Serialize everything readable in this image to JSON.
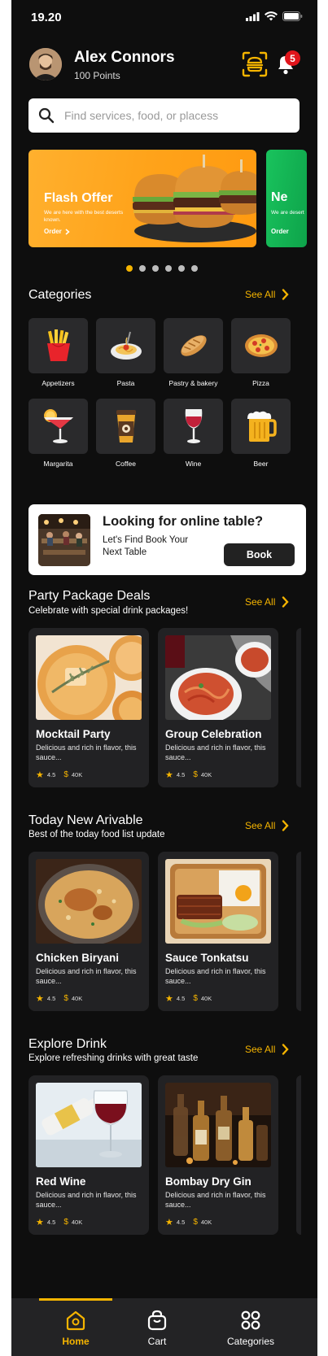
{
  "status": {
    "time": "19.20"
  },
  "header": {
    "name": "Alex Connors",
    "points": "100 Points",
    "notification_count": "5"
  },
  "search": {
    "placeholder": "Find services, food, or placess"
  },
  "banners": [
    {
      "title": "Flash Offer",
      "subtitle": "We are here with the best deserts known.",
      "cta": "Order"
    },
    {
      "title": "Ne",
      "subtitle": "We are desert",
      "cta": "Order"
    }
  ],
  "carousel": {
    "total": 6,
    "active": 0
  },
  "categories": {
    "title": "Categories",
    "see_all": "See All",
    "items": [
      {
        "label": "Appetizers",
        "icon": "fries-icon"
      },
      {
        "label": "Pasta",
        "icon": "pasta-icon"
      },
      {
        "label": "Pastry & bakery",
        "icon": "bread-icon"
      },
      {
        "label": "Pizza",
        "icon": "pizza-icon"
      },
      {
        "label": "Margarita",
        "icon": "cocktail-icon"
      },
      {
        "label": "Coffee",
        "icon": "coffee-cup-icon"
      },
      {
        "label": "Wine",
        "icon": "wine-glass-icon"
      },
      {
        "label": "Beer",
        "icon": "beer-mug-icon"
      }
    ]
  },
  "table_promo": {
    "title": "Looking for online table?",
    "subtitle": "Let's Find Book Your Next Table",
    "button": "Book"
  },
  "sections": [
    {
      "title": "Party Package Deals",
      "subtitle": "Celebrate with special drink packages!",
      "see_all": "See All",
      "cards": [
        {
          "title": "Mocktail Party",
          "desc": "Delicious and rich in flavor, this sauce...",
          "rating": "4.5",
          "price": "40K"
        },
        {
          "title": "Group Celebration",
          "desc": "Delicious and rich in flavor, this sauce...",
          "rating": "4.5",
          "price": "40K"
        }
      ]
    },
    {
      "title": "Today New Arivable",
      "subtitle": "Best of the today food list update",
      "see_all": "See All",
      "cards": [
        {
          "title": "Chicken Biryani",
          "desc": "Delicious and rich in flavor, this sauce...",
          "rating": "4.5",
          "price": "40K"
        },
        {
          "title": "Sauce Tonkatsu",
          "desc": "Delicious and rich in flavor, this sauce...",
          "rating": "4.5",
          "price": "40K"
        }
      ]
    },
    {
      "title": "Explore Drink",
      "subtitle": "Explore refreshing drinks with great taste",
      "see_all": "See All",
      "cards": [
        {
          "title": "Red Wine",
          "desc": "Delicious and rich in flavor, this sauce...",
          "rating": "4.5",
          "price": "40K"
        },
        {
          "title": "Bombay Dry Gin",
          "desc": "Delicious and rich in flavor, this sauce...",
          "rating": "4.5",
          "price": "40K"
        }
      ]
    }
  ],
  "nav": {
    "items": [
      {
        "label": "Home",
        "icon": "home-icon",
        "active": true
      },
      {
        "label": "Cart",
        "icon": "shopping-bag-icon",
        "active": false
      },
      {
        "label": "Categories",
        "icon": "grid-icon",
        "active": false
      }
    ]
  },
  "colors": {
    "accent": "#f5b400",
    "background": "#0e0e0e",
    "card": "#222224",
    "badge": "#e0151c"
  }
}
